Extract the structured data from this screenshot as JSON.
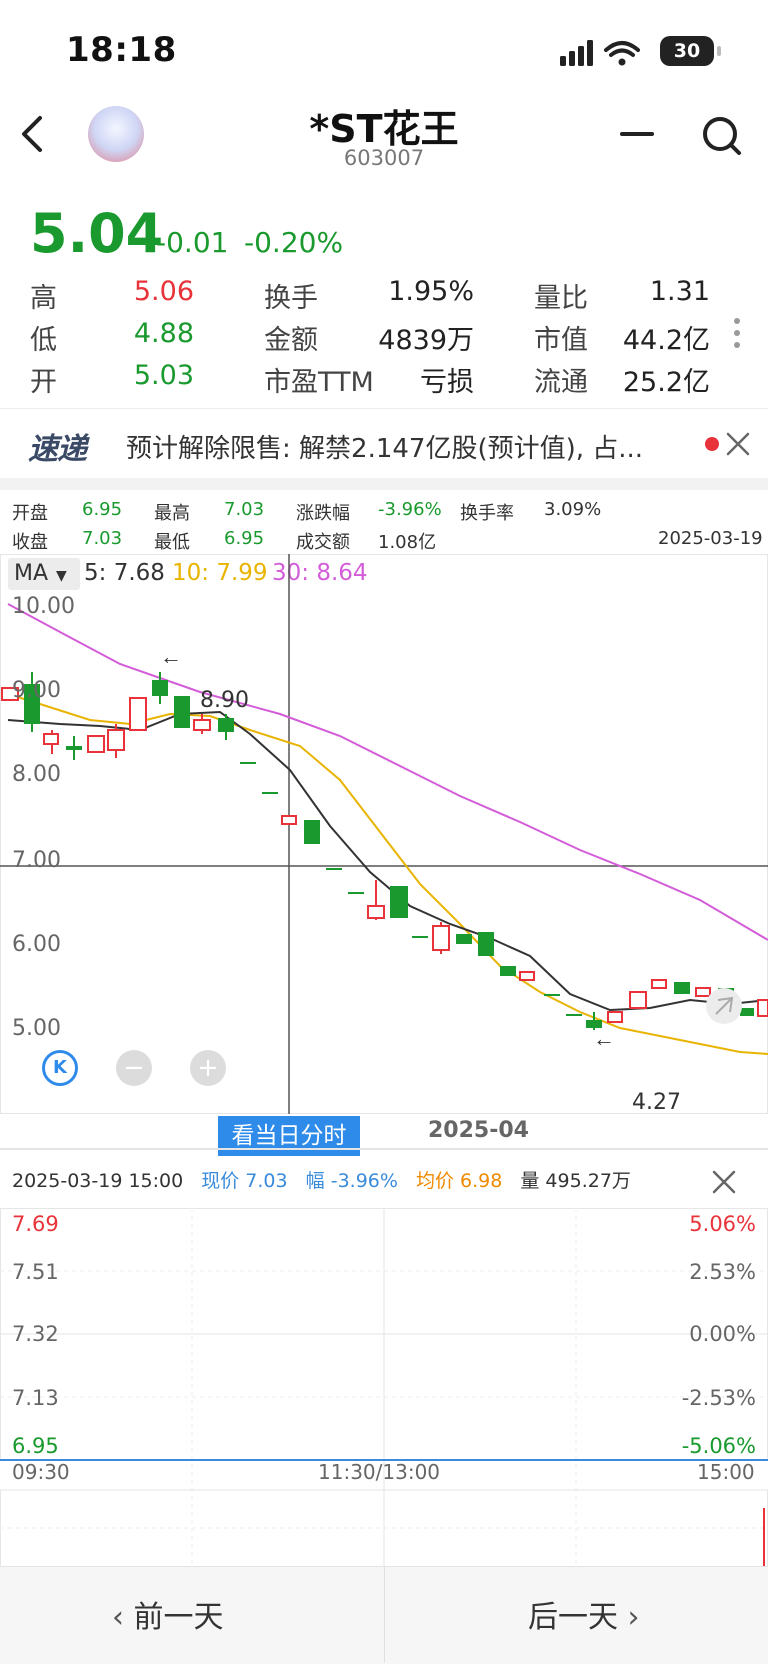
{
  "status": {
    "time": "18:18",
    "battery": "30"
  },
  "header": {
    "title": "*ST花王",
    "code": "603007"
  },
  "quote": {
    "price": "5.04",
    "change": "-0.01",
    "change_pct": "-0.20%",
    "rows": [
      [
        {
          "label": "高",
          "value": "5.06",
          "color": "red"
        },
        {
          "label": "换手",
          "value": "1.95%"
        },
        {
          "label": "量比",
          "value": "1.31"
        }
      ],
      [
        {
          "label": "低",
          "value": "4.88",
          "color": "green"
        },
        {
          "label": "金额",
          "value": "4839万"
        },
        {
          "label": "市值",
          "value": "44.2亿"
        }
      ],
      [
        {
          "label": "开",
          "value": "5.03",
          "color": "green"
        },
        {
          "label": "市盈TTM",
          "value": "亏损"
        },
        {
          "label": "流通",
          "value": "25.2亿"
        }
      ]
    ]
  },
  "news": {
    "logo": "速递",
    "text": "预计解除限售: 解禁2.147亿股(预计值), 占..."
  },
  "day_info": {
    "open_label": "开盘",
    "open": "6.95",
    "high_label": "最高",
    "high": "7.03",
    "change_label": "涨跌幅",
    "change": "-3.96%",
    "turnover_label": "换手率",
    "turnover": "3.09%",
    "close_label": "收盘",
    "close": "7.03",
    "low_label": "最低",
    "low": "6.95",
    "amount_label": "成交额",
    "amount": "1.08亿",
    "date": "2025-03-19"
  },
  "ma": {
    "selector": "MA",
    "ma5": "5: 7.68",
    "ma10": "10: 7.99",
    "ma30": "30: 8.64"
  },
  "kline": {
    "y_labels": [
      "10.00",
      "9.00",
      "8.00",
      "7.00",
      "6.00",
      "5.00"
    ],
    "high_mark": "8.90",
    "low_mark": "4.27",
    "view_day_button": "看当日分时",
    "month_label": "2025-04"
  },
  "intraday": {
    "datetime": "2025-03-19  15:00",
    "price_label": "现价 7.03",
    "range_label": "幅 -3.96%",
    "avg_label": "均价 6.98",
    "vol_label": "量 495.27万",
    "left_axis": [
      "7.69",
      "7.51",
      "7.32",
      "7.13",
      "6.95"
    ],
    "right_axis": [
      "5.06%",
      "2.53%",
      "0.00%",
      "-2.53%",
      "-5.06%"
    ],
    "times": [
      "09:30",
      "11:30/13:00",
      "15:00"
    ]
  },
  "nav": {
    "prev": "前一天",
    "next": "后一天"
  },
  "colors": {
    "up": "#e8333a",
    "down": "#1a9a2e",
    "ma5": "#333333",
    "ma10": "#e8b400",
    "ma30": "#d35cd8",
    "accent": "#2e8bea"
  }
}
